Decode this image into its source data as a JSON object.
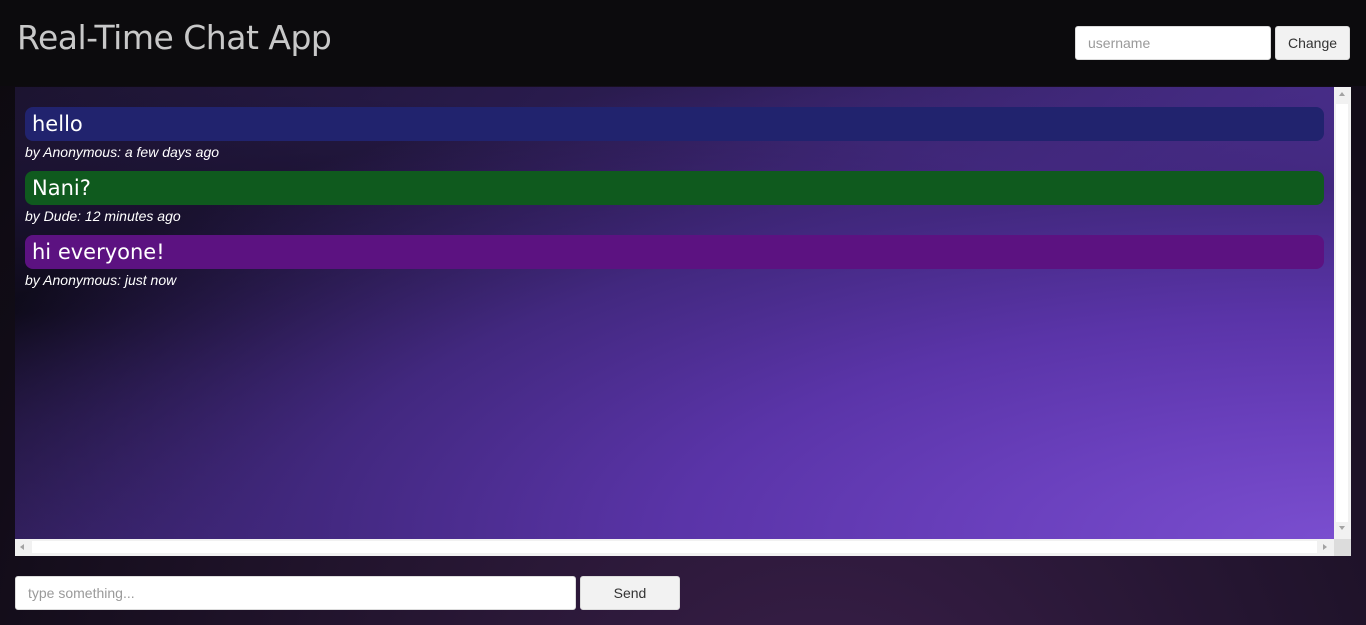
{
  "header": {
    "title": "Real-Time Chat App",
    "username_placeholder": "username",
    "username_value": "",
    "change_label": "Change"
  },
  "messages": [
    {
      "text": "hello",
      "meta": "by Anonymous: a few days ago",
      "color": "#21236e"
    },
    {
      "text": "Nani?",
      "meta": "by Dude: 12 minutes ago",
      "color": "#0f5a1e"
    },
    {
      "text": "hi everyone!",
      "meta": "by Anonymous: just now",
      "color": "#5c1281"
    }
  ],
  "composer": {
    "placeholder": "type something...",
    "value": "",
    "send_label": "Send"
  },
  "icons": {
    "scroll_up": "scroll-up-arrow-icon",
    "scroll_down": "scroll-down-arrow-icon",
    "scroll_left": "scroll-left-arrow-icon",
    "scroll_right": "scroll-right-arrow-icon"
  }
}
